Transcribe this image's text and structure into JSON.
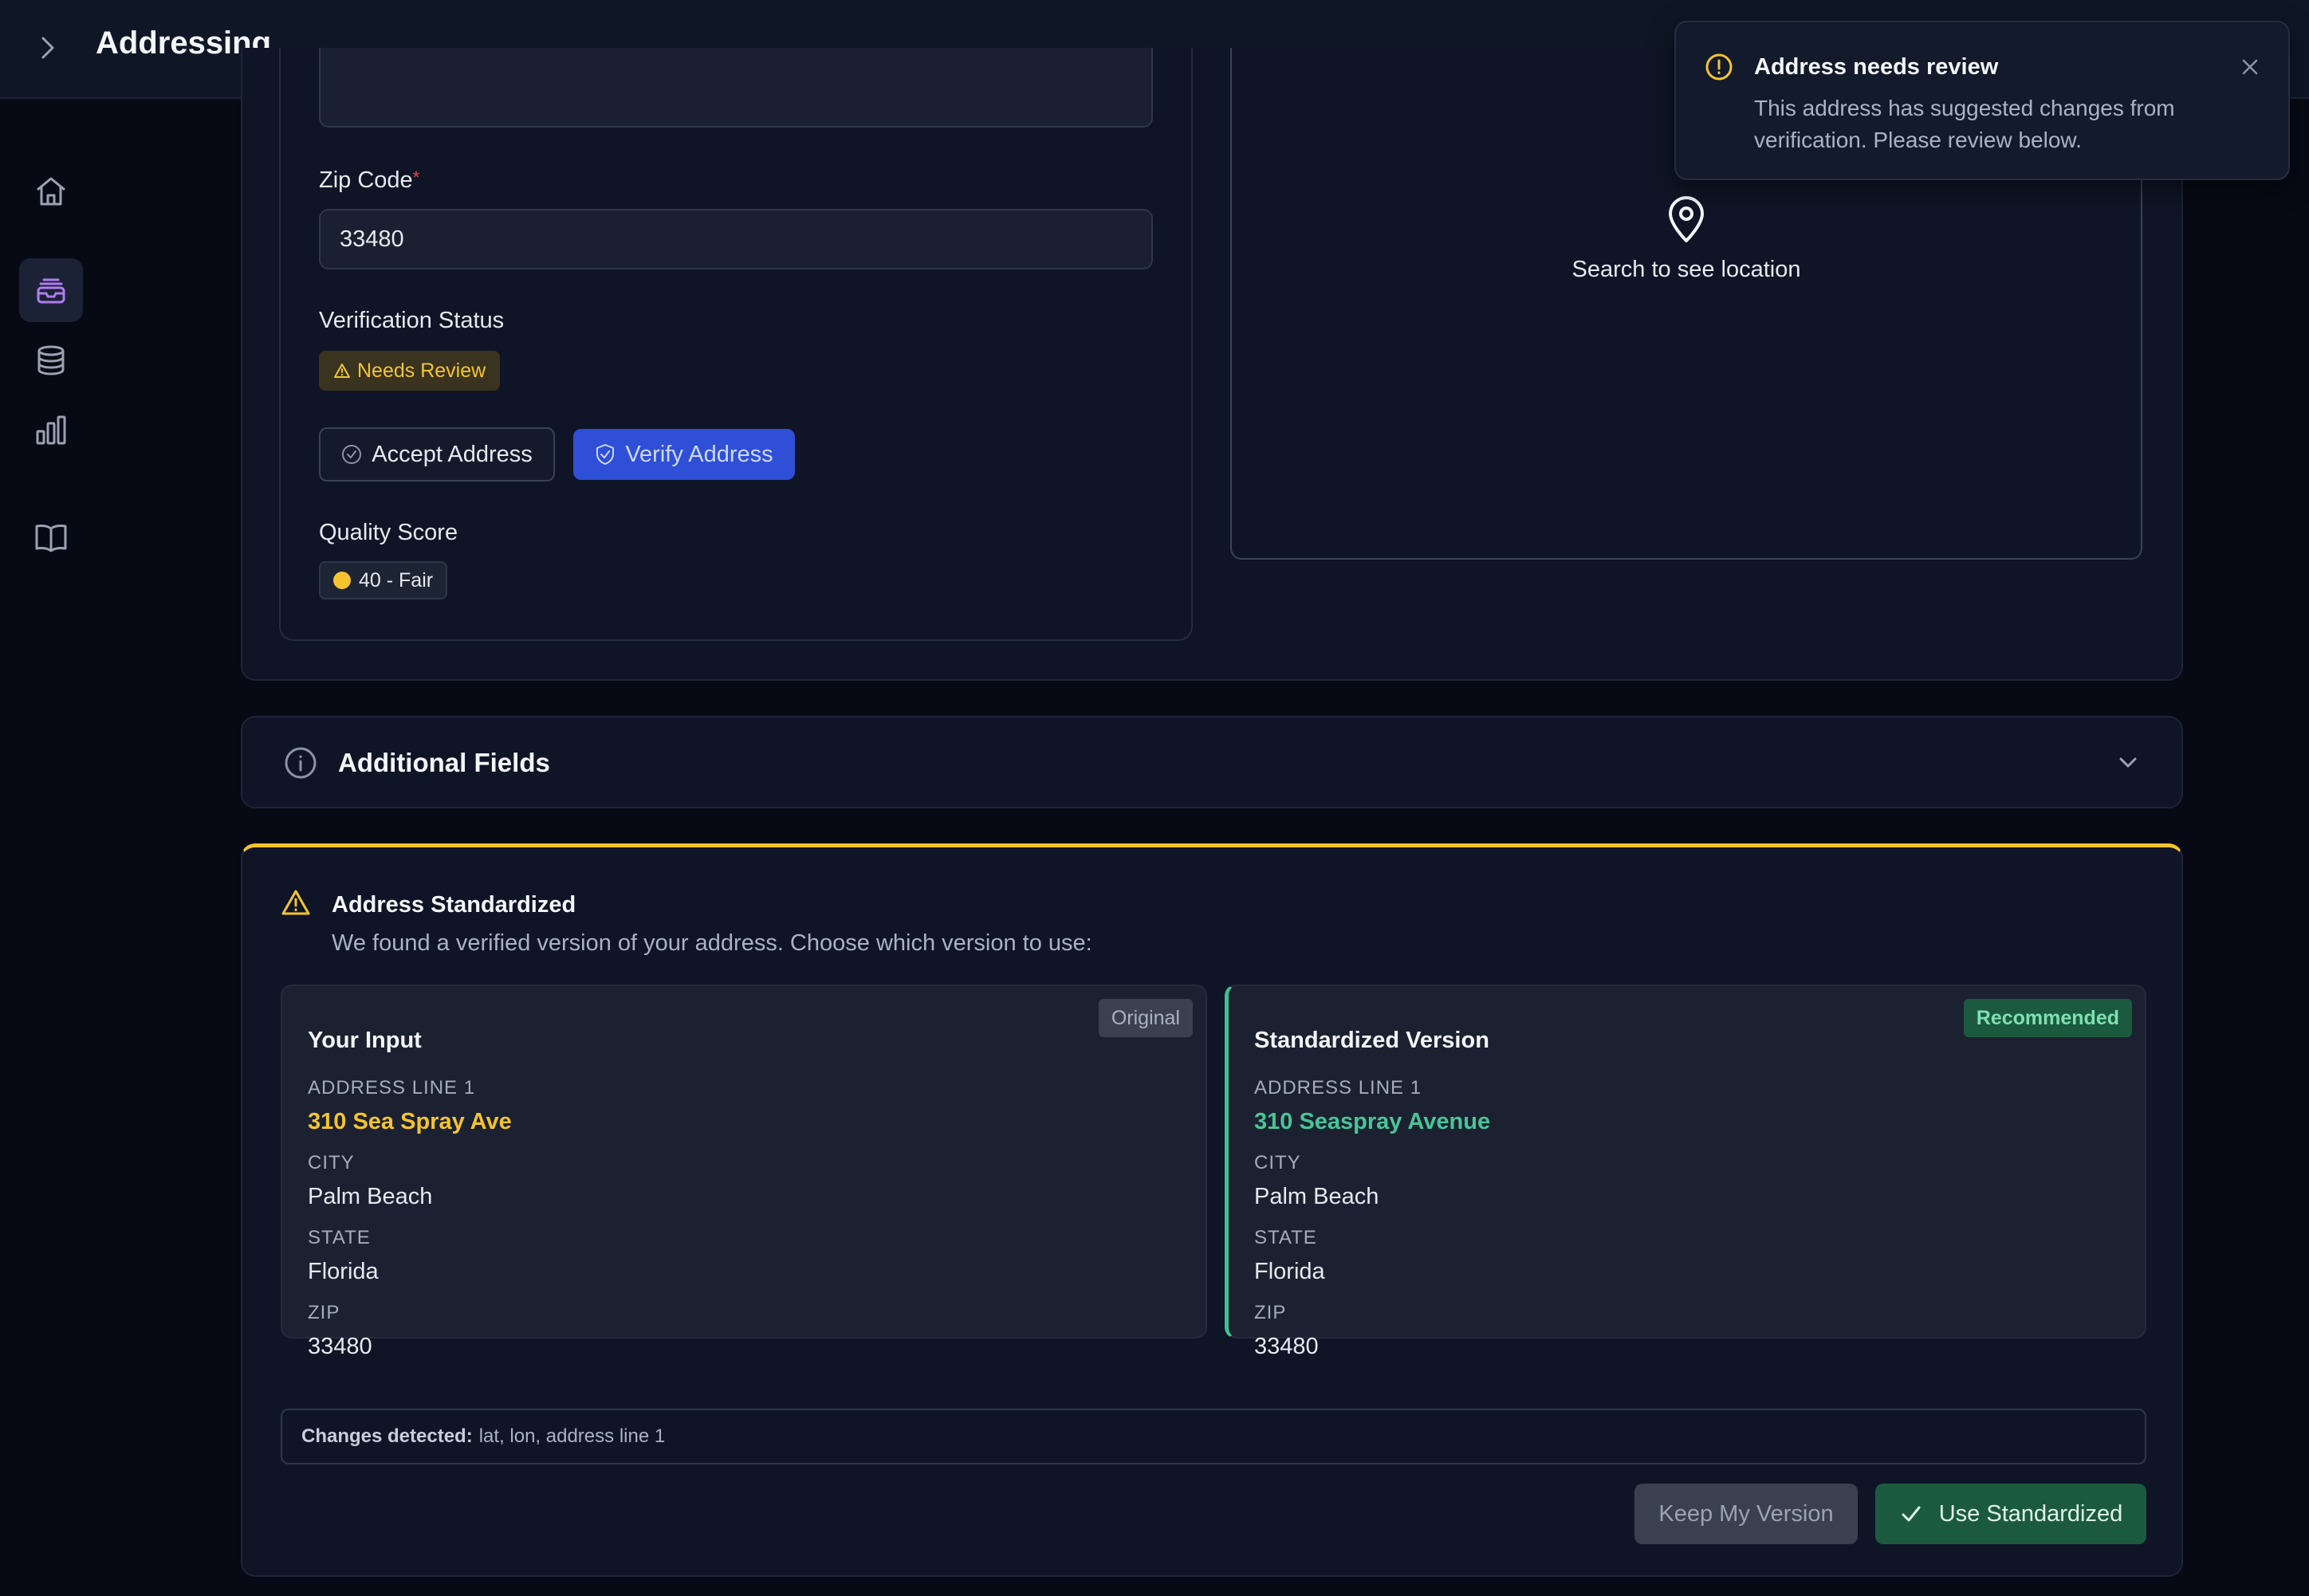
{
  "app": {
    "title": "Addressing"
  },
  "sidebar": {
    "items": [
      {
        "name": "home",
        "icon": "home-icon"
      },
      {
        "name": "addressing",
        "icon": "inbox-stack-icon",
        "active": true
      },
      {
        "name": "database",
        "icon": "database-icon"
      },
      {
        "name": "analytics",
        "icon": "bar-chart-icon"
      },
      {
        "name": "docs",
        "icon": "book-icon"
      }
    ]
  },
  "form": {
    "zip_label": "Zip Code",
    "required_mark": "*",
    "zip_value": "33480",
    "verification_label": "Verification Status",
    "verification_badge": "Needs Review",
    "accept_button": "Accept Address",
    "verify_button": "Verify Address",
    "quality_label": "Quality Score",
    "quality_badge": "40 - Fair"
  },
  "map": {
    "placeholder": "Search to see location"
  },
  "additional_fields": {
    "label": "Additional Fields"
  },
  "standardized": {
    "title": "Address Standardized",
    "subtitle": "We found a verified version of your address. Choose which version to use:",
    "original": {
      "tag": "Original",
      "title": "Your Input",
      "address_line_label": "ADDRESS LINE 1",
      "address_line": "310 Sea Spray Ave",
      "city_label": "CITY",
      "city": "Palm Beach",
      "state_label": "STATE",
      "state": "Florida",
      "zip_label": "ZIP",
      "zip": "33480"
    },
    "recommended": {
      "tag": "Recommended",
      "title": "Standardized Version",
      "address_line_label": "ADDRESS LINE 1",
      "address_line": "310 Seaspray Avenue",
      "city_label": "CITY",
      "city": "Palm Beach",
      "state_label": "STATE",
      "state": "Florida",
      "zip_label": "ZIP",
      "zip": "33480"
    },
    "changes_label": "Changes detected:",
    "changes_value": "lat, lon, address line 1",
    "keep_button": "Keep My Version",
    "use_button": "Use Standardized"
  },
  "toast": {
    "title": "Address needs review",
    "body": "This address has suggested changes from verification. Please review below."
  },
  "colors": {
    "accent_blue": "#2e4fd6",
    "warning": "#f4c430",
    "success": "#3ec28f"
  }
}
